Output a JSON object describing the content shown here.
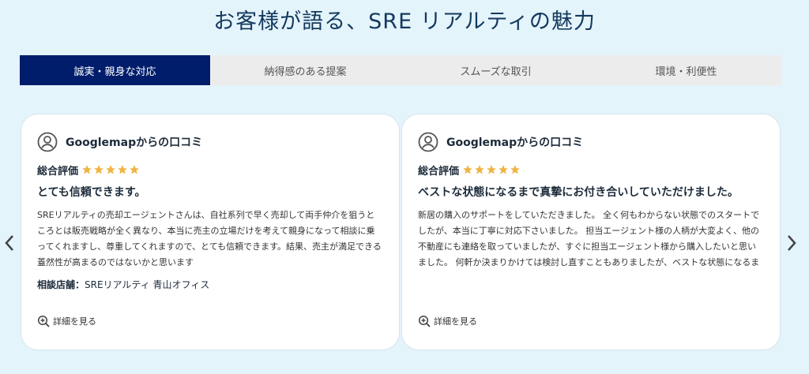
{
  "page": {
    "title": "お客様が語る、SRE リアルティの魅力"
  },
  "tabs": [
    {
      "label": "誠実・親身な対応",
      "active": true
    },
    {
      "label": "納得感のある提案",
      "active": false
    },
    {
      "label": "スムーズな取引",
      "active": false
    },
    {
      "label": "環境・利便性",
      "active": false
    }
  ],
  "colors": {
    "accent": "#001d6c",
    "star": "#f0b443",
    "background": "#e4f4fb"
  },
  "reviews": [
    {
      "source": "Googlemapからの口コミ",
      "rating_label": "総合評価",
      "stars": 5,
      "headline": "とても信頼できます。",
      "body": "SREリアルティの売却エージェントさんは、自社系列で早く売却して両手仲介を狙うところとは販売戦略が全く異なり、本当に売主の立場だけを考えて親身になって相談に乗ってくれますし、尊重してくれますので、とても信頼できます。結果、売主が満足できる蓋然性が高まるのではないかと思います",
      "store_label": "相談店舗：",
      "store_value": "SREリアルティ 青山オフィス",
      "more_label": "詳細を見る"
    },
    {
      "source": "Googlemapからの口コミ",
      "rating_label": "総合評価",
      "stars": 5,
      "headline": "ベストな状態になるまで真摯にお付き合いしていただけました。",
      "body": "新居の購入のサポートをしていただきました。 全く何もわからない状態でのスタートでしたが、本当に丁寧に対応下さいました。 担当エージェント様の人柄が大変よく、他の不動産にも連絡を取っていましたが、すぐに担当エージェント様から購入したいと思いました。 何軒か決まりかけては検討し直すこともありましたが、ベストな状態になるまで真摯にお付き合いしていただけました",
      "more_label": "詳細を見る"
    }
  ],
  "icons": {
    "user": "user-circle-icon",
    "star": "star-icon",
    "zoom": "zoom-in-icon",
    "prev": "chevron-left-icon",
    "next": "chevron-right-icon"
  }
}
